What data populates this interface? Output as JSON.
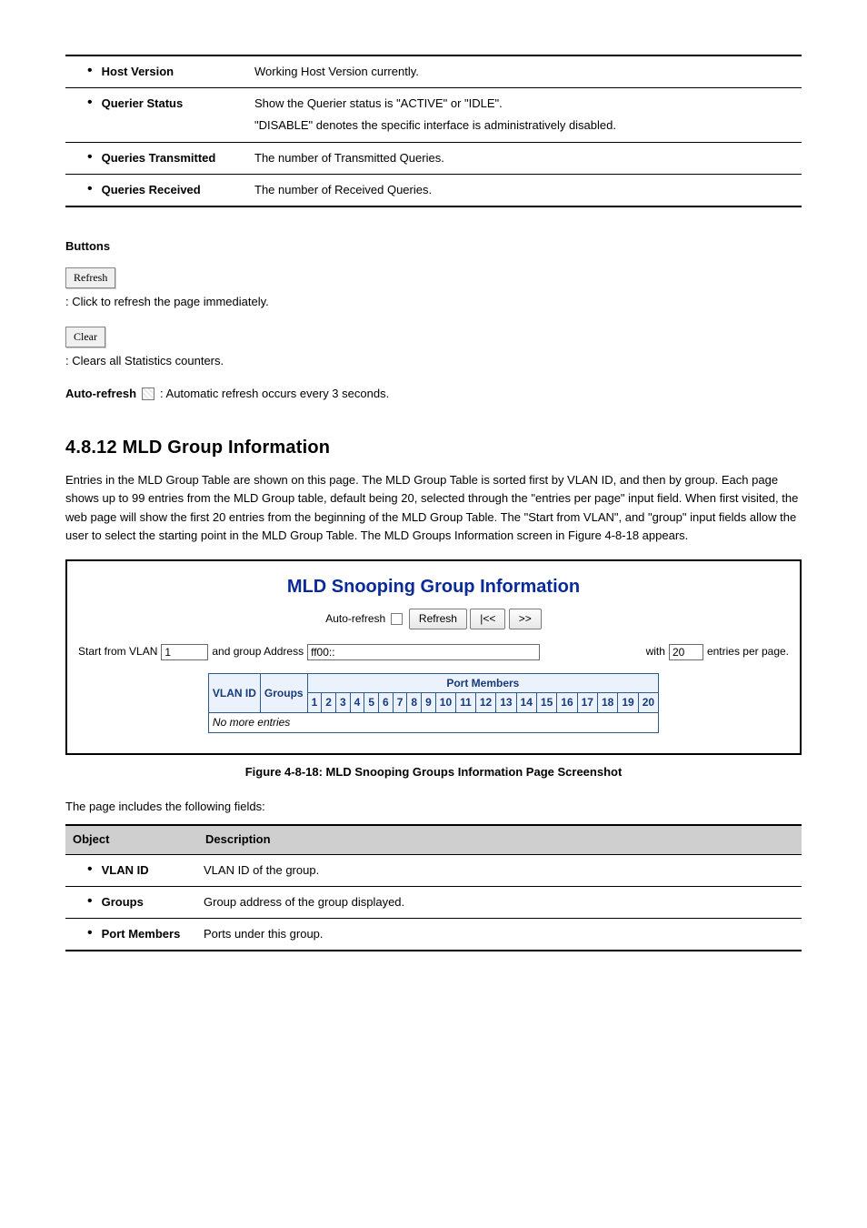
{
  "top_table": {
    "rows": [
      {
        "label": "Host Version",
        "desc": "Working Host Version currently."
      },
      {
        "label": "Querier Status",
        "desc_html": [
          "Show the Querier status is \"ACTIVE\" or \"IDLE\".",
          "\"DISABLE\" denotes the specific interface is administratively disabled."
        ]
      },
      {
        "label": "Queries Transmitted",
        "desc": "The number of Transmitted Queries."
      },
      {
        "label": "Queries Received",
        "desc": "The number of Received Queries."
      }
    ]
  },
  "buttons": {
    "refresh_label": "Refresh",
    "refresh_desc": ": Click to refresh the page immediately.",
    "clear_label": "Clear",
    "clear_desc": ": Clears all Statistics counters.",
    "auto_label": "Auto-refresh",
    "auto_desc": ": Automatic refresh occurs every 3 seconds."
  },
  "section": {
    "number": "4.8.12",
    "title": "MLD Group Information",
    "para": "Entries in the MLD Group Table are shown on this page. The MLD Group Table is sorted first by VLAN ID, and then by group. Each page shows up to 99 entries from the MLD Group table, default being 20, selected through the \"entries per page\" input field. When first visited, the web page will show the first 20 entries from the beginning of the MLD Group Table. The \"Start from VLAN\", and \"group\" input fields allow the user to select the starting point in the MLD Group Table. The MLD Groups Information screen in Figure 4-8-18 appears."
  },
  "screenshot": {
    "title": "MLD Snooping Group Information",
    "auto_refresh_label": "Auto-refresh",
    "refresh_btn": "Refresh",
    "first_btn": "|<<",
    "next_btn": ">>",
    "start_vlan_label_pre": "Start from VLAN",
    "start_vlan_value": "1",
    "group_addr_label": "and group Address",
    "group_addr_value": "ff00::",
    "with_label": "with",
    "entries_value": "20",
    "entries_suffix": "entries per page.",
    "col_vlan": "VLAN ID",
    "col_groups": "Groups",
    "col_port_members": "Port Members",
    "ports": [
      "1",
      "2",
      "3",
      "4",
      "5",
      "6",
      "7",
      "8",
      "9",
      "10",
      "11",
      "12",
      "13",
      "14",
      "15",
      "16",
      "17",
      "18",
      "19",
      "20"
    ],
    "empty_msg": "No more entries"
  },
  "figure_caption": "Figure 4-8-18: MLD Snooping Groups Information Page Screenshot",
  "bottom_intro": "The page includes the following fields:",
  "bottom_table": {
    "head_object": "Object",
    "head_desc": "Description",
    "rows": [
      {
        "label": "VLAN ID",
        "desc": "VLAN ID of the group."
      },
      {
        "label": "Groups",
        "desc": "Group address of the group displayed."
      },
      {
        "label": "Port Members",
        "desc": "Ports under this group."
      }
    ]
  }
}
